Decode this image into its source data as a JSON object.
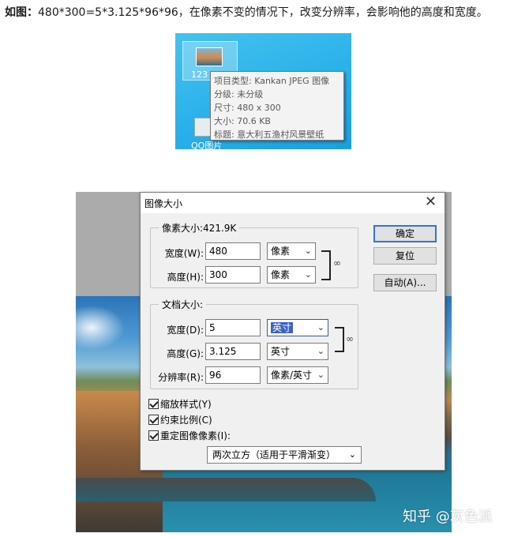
{
  "caption": {
    "bold": "如图：",
    "text": "480*300=5*3.125*96*96，在像素不变的情况下，改变分辨率，会影响他的高度和宽度。"
  },
  "desktop": {
    "icon1_label": "123",
    "icon2_label": "QQ图片",
    "tooltip": [
      "项目类型: Kankan JPEG 图像",
      "分级: 未分级",
      "尺寸: 480 x 300",
      "大小: 70.6 KB",
      "标题: 意大利五渔村风景壁纸"
    ]
  },
  "dialog": {
    "title": "图像大小",
    "close": "✕",
    "pixel_group": {
      "legend": "像素大小:421.9K",
      "width_label": "宽度(W):",
      "width_value": "480",
      "width_unit": "像素",
      "height_label": "高度(H):",
      "height_value": "300",
      "height_unit": "像素"
    },
    "doc_group": {
      "legend": "文档大小:",
      "width_label": "宽度(D):",
      "width_value": "5",
      "width_unit": "英寸",
      "height_label": "高度(G):",
      "height_value": "3.125",
      "height_unit": "英寸",
      "res_label": "分辨率(R):",
      "res_value": "96",
      "res_unit": "像素/英寸"
    },
    "buttons": {
      "ok": "确定",
      "reset": "复位",
      "auto": "自动(A)..."
    },
    "checkboxes": {
      "scale_styles": "缩放样式(Y)",
      "constrain": "约束比例(C)",
      "resample": "重定图像像素(I):"
    },
    "resample_method": "两次立方（适用于平滑渐变）"
  },
  "watermark": "知乎 @灰色派"
}
